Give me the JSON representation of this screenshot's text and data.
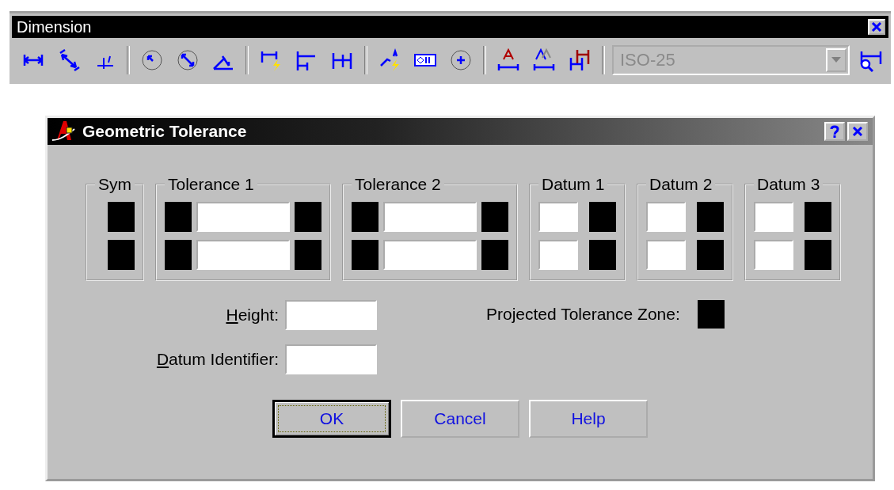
{
  "toolbar": {
    "title": "Dimension",
    "style_select": {
      "value": "ISO-25",
      "disabled": true
    }
  },
  "dialog": {
    "title": "Geometric Tolerance",
    "frames": [
      {
        "label": "Sym",
        "kind": "symbol"
      },
      {
        "label": "Tolerance 1",
        "kind": "tolerance"
      },
      {
        "label": "Tolerance 2",
        "kind": "tolerance"
      },
      {
        "label": "Datum 1",
        "kind": "datum"
      },
      {
        "label": "Datum 2",
        "kind": "datum"
      },
      {
        "label": "Datum 3",
        "kind": "datum"
      }
    ],
    "fields": [
      {
        "label": "Height:"
      },
      {
        "label": "Datum Identifier:"
      }
    ],
    "projected_zone": {
      "label": "Projected Tolerance Zone:"
    },
    "buttons": [
      {
        "label": "OK",
        "focused": true
      },
      {
        "label": "Cancel",
        "focused": false
      },
      {
        "label": "Help",
        "focused": false
      }
    ]
  }
}
